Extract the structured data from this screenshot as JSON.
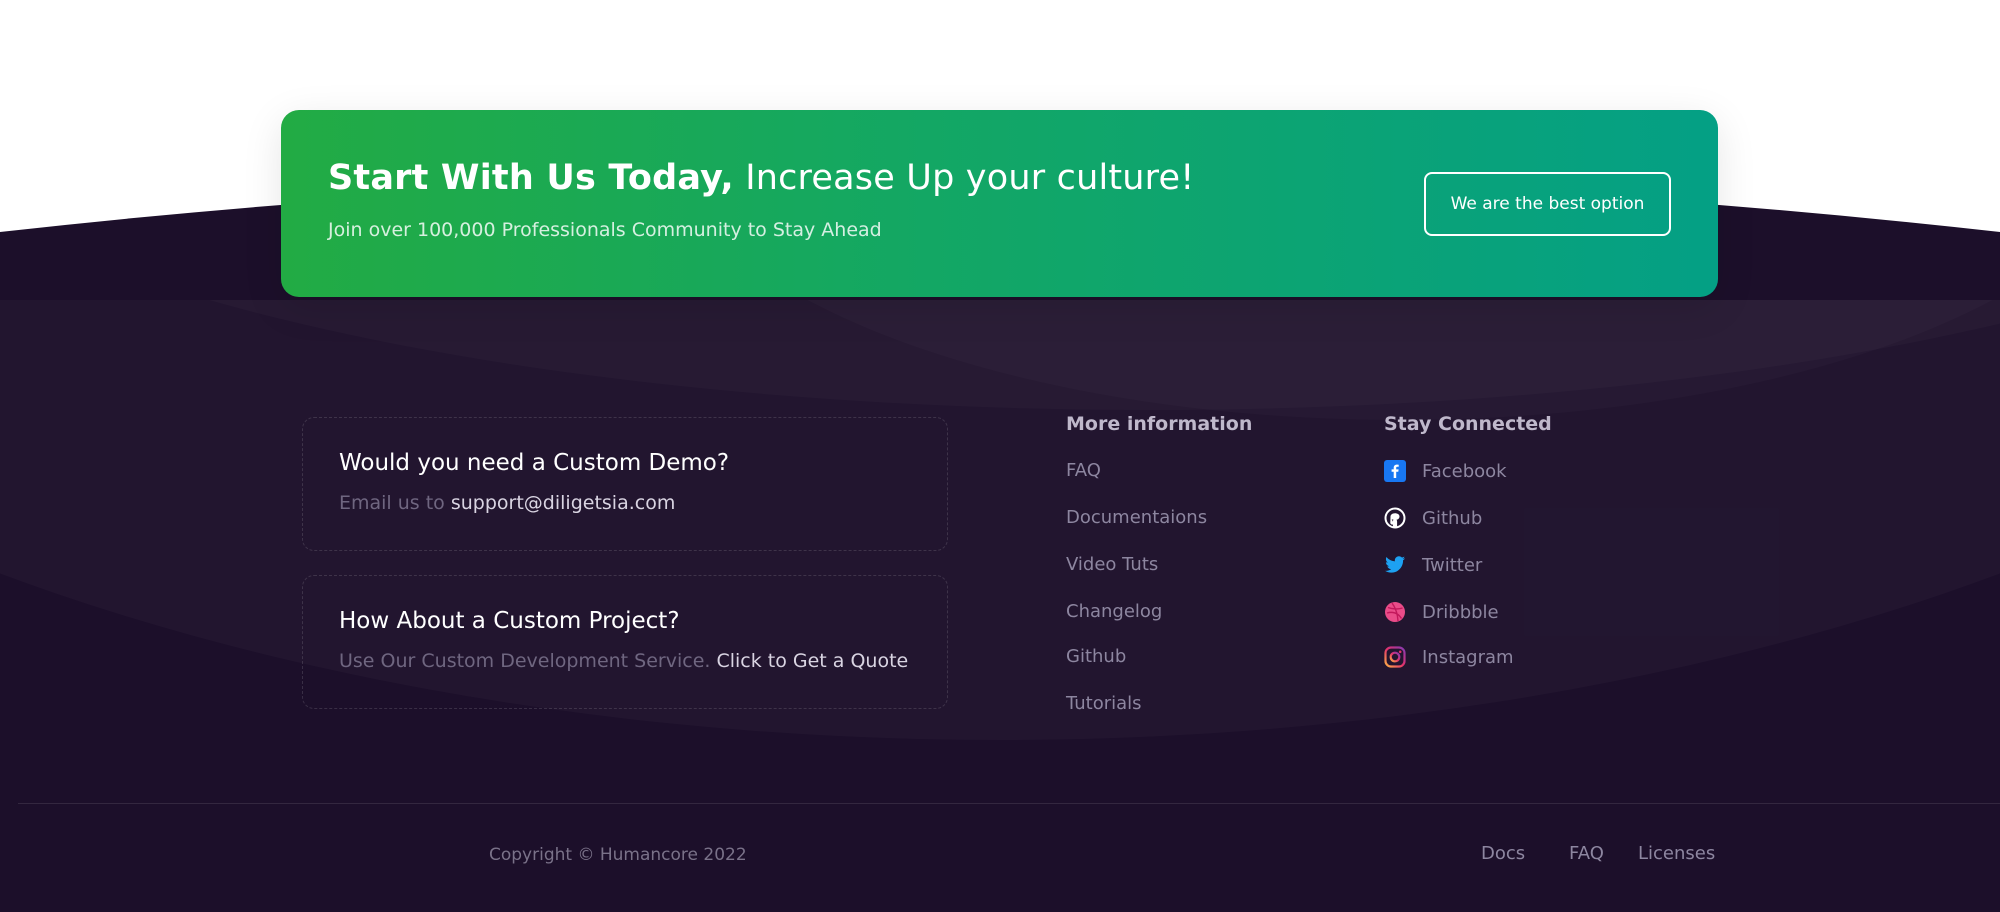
{
  "banner": {
    "title_bold": "Start With Us Today,",
    "title_light": "Increase Up your culture!",
    "subtitle": "Join over 100,000 Professionals Community to Stay Ahead",
    "button_label": "We are the best option"
  },
  "cards": [
    {
      "title": "Would you need a Custom Demo?",
      "text": "Email us to",
      "link": "support@diligetsia.com"
    },
    {
      "title": "How About a Custom Project?",
      "text": "Use Our Custom Development Service.",
      "link": "Click to Get a Quote"
    }
  ],
  "more_info": {
    "heading": "More information",
    "items": [
      "FAQ",
      "Documentaions",
      "Video Tuts",
      "Changelog",
      "Github",
      "Tutorials"
    ]
  },
  "stay_connected": {
    "heading": "Stay Connected",
    "items": [
      {
        "label": "Facebook",
        "icon": "facebook-icon",
        "color": "#1877f2"
      },
      {
        "label": "Github",
        "icon": "github-icon",
        "color": "#ffffff"
      },
      {
        "label": "Twitter",
        "icon": "twitter-icon",
        "color": "#1da1f2"
      },
      {
        "label": "Dribbble",
        "icon": "dribbble-icon",
        "color": "#ea4c89"
      },
      {
        "label": "Instagram",
        "icon": "instagram-icon",
        "color": "#e1306c"
      }
    ]
  },
  "bottom_bar": {
    "copyright": "Copyright © Humancore 2022",
    "links": [
      "Docs",
      "FAQ",
      "Licenses"
    ]
  },
  "colors": {
    "footer_bg": "#1c0f2a",
    "banner_gradient_start": "#22ab44",
    "banner_gradient_end": "#04a085"
  }
}
